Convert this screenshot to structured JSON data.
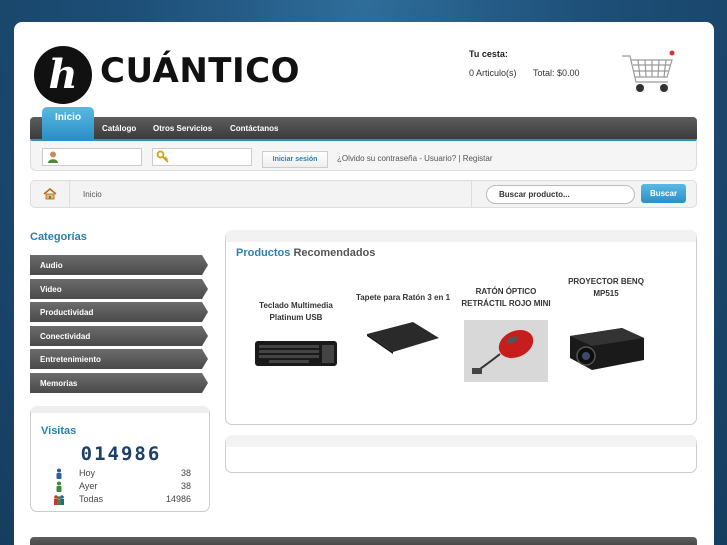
{
  "header": {
    "logo_letter": "h",
    "logo_text": "CUÁNTICO",
    "cart": {
      "label": "Tu cesta:",
      "items": "0 Articulo(s)",
      "total": "Total: $0.00"
    }
  },
  "nav": {
    "items": [
      "Inicio",
      "Catálogo",
      "Otros Servicios",
      "Contáctanos"
    ]
  },
  "login": {
    "button": "Iniciar sesión",
    "links": "¿Olvido su contraseña - Usuario?  |  Registar"
  },
  "breadcrumb": {
    "current": "Inicio"
  },
  "search": {
    "placeholder": "Buscar producto...",
    "button": "Buscar"
  },
  "sidebar": {
    "title": "Categorías",
    "categories": [
      "Audio",
      "Video",
      "Productividad",
      "Conectividad",
      "Entretenimiento",
      "Memorias"
    ]
  },
  "visits": {
    "title": "Visitas",
    "counter": "014986",
    "rows": [
      {
        "label": "Hoy",
        "value": "38"
      },
      {
        "label": "Ayer",
        "value": "38"
      },
      {
        "label": "Todas",
        "value": "14986"
      }
    ]
  },
  "products": {
    "title_highlight": "Productos",
    "title_rest": "Recomendados",
    "items": [
      {
        "name": "Teclado Multimedia Platinum USB",
        "icon": "keyboard-image"
      },
      {
        "name": "Tapete para Ratón 3 en 1",
        "icon": "mousepad-image"
      },
      {
        "name": "RATÓN ÓPTICO RETRÁCTIL ROJO MINI",
        "icon": "mouse-image"
      },
      {
        "name": "PROYECTOR BENQ MP515",
        "icon": "projector-image"
      }
    ]
  },
  "colors": {
    "accent": "#2b8fc7",
    "nav_dark": "#4a4a4a",
    "background": "#1d4f78"
  }
}
